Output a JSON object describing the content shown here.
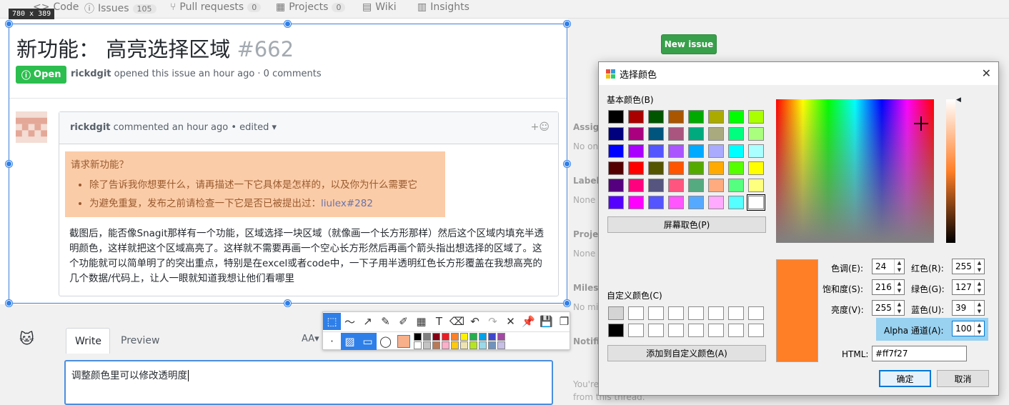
{
  "nav": {
    "tabs": [
      {
        "label": "Code",
        "icon": "code-icon"
      },
      {
        "label": "Issues",
        "count": "105",
        "icon": "issue-icon"
      },
      {
        "label": "Pull requests",
        "count": "0",
        "icon": "pr-icon"
      },
      {
        "label": "Projects",
        "count": "0",
        "icon": "project-icon"
      },
      {
        "label": "Wiki",
        "icon": "wiki-icon"
      },
      {
        "label": "Insights",
        "icon": "graph-icon"
      }
    ]
  },
  "selection": {
    "size_label": "780 x 389"
  },
  "issue": {
    "title": "新功能： 高亮选择区域",
    "number": "#662",
    "status": "Open",
    "author": "rickdgit",
    "meta_rest": "opened this issue an hour ago · 0 comments",
    "new_issue_label": "New issue"
  },
  "comment": {
    "author": "rickdgit",
    "meta": "commented an hour ago • edited ▾",
    "quote_title": "请求新功能？",
    "quote_item1": "除了告诉我你想要什么，请再描述一下它具体是怎样的，以及你为什么需要它",
    "quote_item2_prefix": "为避免重复，发布之前请检查一下它是否已被提出过：",
    "quote_item2_link": "liulex#282",
    "body": "截图后，能否像Snagit那样有一个功能，区域选择一块区域（就像画一个长方形那样）然后这个区域内填充半透明颜色，这样就把这个区域高亮了。这样就不需要再画一个空心长方形然后再画个箭头指出想选择的区域了。这个功能就可以简单明了的突出重点，特别是在excel或者code中，一下子用半透明红色长方形覆盖在我想高亮的几个数据/代码上，让人一眼就知道我想让他们看哪里"
  },
  "sidebar": {
    "assignees": "Assignees",
    "assignees_sub": "No one",
    "labels": "Labels",
    "labels_sub": "None yet",
    "projects": "Projects",
    "projects_sub": "None yet",
    "milestone": "Milestone",
    "milestone_sub": "No milestone",
    "notifications": "Notifications",
    "notif_sub1": "You're",
    "notif_sub2": "from this thread."
  },
  "editor": {
    "write_tab": "Write",
    "preview_tab": "Preview",
    "text": "调整颜色里可以修改透明度"
  },
  "dialog": {
    "title": "选择颜色",
    "basic_colors_label": "基本颜色(B)",
    "pick_screen_label": "屏幕取色(P)",
    "custom_colors_label": "自定义颜色(C)",
    "add_custom_label": "添加到自定义颜色(A)",
    "basic_colors": [
      "#000000",
      "#aa0000",
      "#005500",
      "#aa5500",
      "#00aa00",
      "#aaaa00",
      "#00ff00",
      "#aaff00",
      "#00007f",
      "#aa007f",
      "#00557f",
      "#aa557f",
      "#00aa7f",
      "#aaaa7f",
      "#00ff7f",
      "#aaff7f",
      "#0000ff",
      "#aa00ff",
      "#5555ff",
      "#aa55ff",
      "#00aaff",
      "#aaaaff",
      "#00ffff",
      "#aaffff",
      "#550000",
      "#ff0000",
      "#555500",
      "#ff5500",
      "#55aa00",
      "#ffaa00",
      "#55ff00",
      "#ffff00",
      "#55007f",
      "#ff007f",
      "#55557f",
      "#ff557f",
      "#55aa7f",
      "#ffaa7f",
      "#55ff7f",
      "#ffff7f",
      "#5500ff",
      "#ff00ff",
      "#5555ff",
      "#ff55ff",
      "#55aaff",
      "#ffaaff",
      "#55ffff",
      "#ffffff"
    ],
    "custom_colors": [
      "#d4d4d4",
      "#ffffff",
      "#ffffff",
      "#ffffff",
      "#ffffff",
      "#ffffff",
      "#ffffff",
      "#ffffff",
      "#000000",
      "#ffffff",
      "#ffffff",
      "#ffffff",
      "#ffffff",
      "#ffffff",
      "#ffffff",
      "#ffffff"
    ],
    "hue_label": "色调(E):",
    "hue": "24",
    "sat_label": "饱和度(S):",
    "sat": "216",
    "val_label": "亮度(V):",
    "val": "255",
    "red_label": "红色(R):",
    "red": "255",
    "green_label": "绿色(G):",
    "green": "127",
    "blue_label": "蓝色(U):",
    "blue": "39",
    "alpha_label": "Alpha 通道(A):",
    "alpha": "100",
    "html_label": "HTML:",
    "html": "#ff7f27",
    "ok_label": "确定",
    "cancel_label": "取消",
    "current_color": "#ff7f27"
  },
  "toolbar": {
    "palette": [
      "#000000",
      "#7f7f7f",
      "#880015",
      "#ed1c24",
      "#ff7f27",
      "#fff200",
      "#22b14c",
      "#00a2e8",
      "#3f48cc",
      "#a349a4",
      "#ffffff",
      "#c3c3c3",
      "#b97a57",
      "#ffaec9",
      "#ffc90e",
      "#efe4b0",
      "#b5e61d",
      "#99d9ea",
      "#7092be",
      "#c8bfe7"
    ]
  }
}
